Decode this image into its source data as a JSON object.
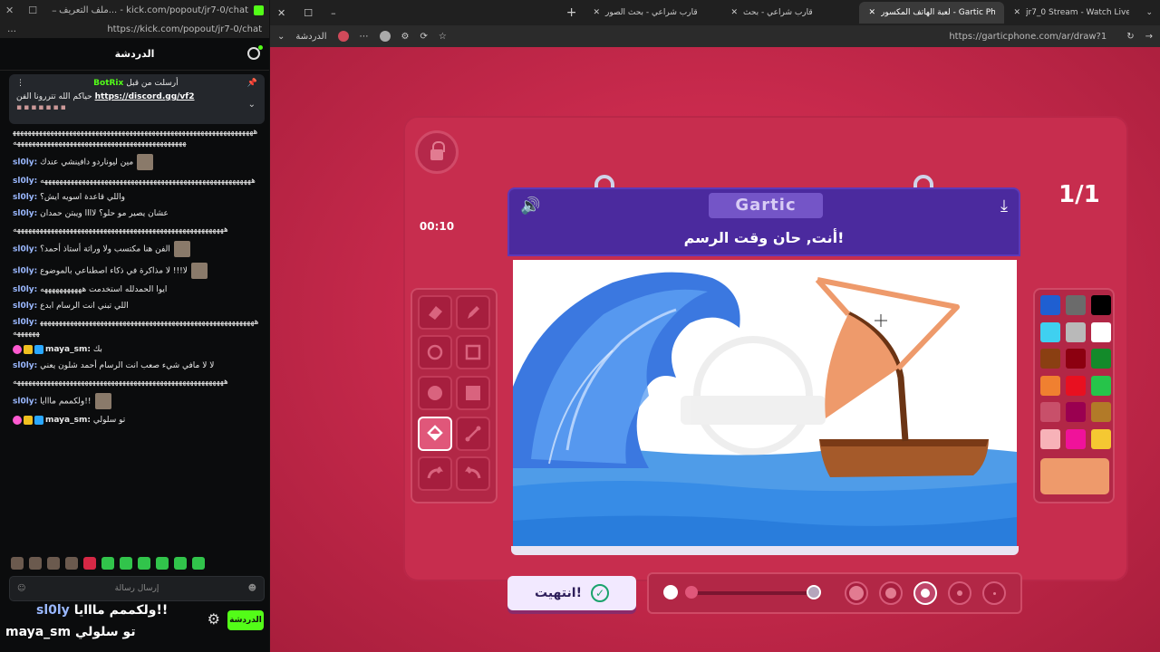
{
  "chat_window": {
    "title": "ملف التعريف... - kick.com/popout/jr7-0/chat",
    "url": "https://kick.com/popout/jr7-0/chat",
    "header": "الدردشة",
    "pinned": {
      "label": "أرسلت من قبل",
      "bot": "BotRix",
      "text": "حياكم الله تتررونا الفن",
      "link": "https://discord.gg/vf2"
    },
    "messages": [
      {
        "user": "",
        "text": "ههههههههههههههههههههههههههههههههههههههههههههههههههههههههههههههههههههههههههههههههههههههههههههههههههههههههههههههه"
      },
      {
        "user": "sl0ly:",
        "text": "مين ليوناردو دافينشي عندك"
      },
      {
        "user": "sl0ly:",
        "text": "ههههههههههههههههههههههههههههههههههههههههههههههههههههههههه"
      },
      {
        "user": "sl0ly:",
        "text": "واللي قاعدة اسويه ايش؟"
      },
      {
        "user": "sl0ly:",
        "text": "عشان يصير مو حلو؟ لاااا ويبتن حمدان"
      },
      {
        "user": "",
        "text": "ههههههههههههههههههههههههههههههههههههههههههههههههههههههههه"
      },
      {
        "user": "sl0ly:",
        "text": "الفن هنا مكتسب ولا وراثة أستاذ أحمد؟"
      },
      {
        "user": "sl0ly:",
        "text": "لا!!! لا مذاكرة في ذكاء اصطناعي بالموضوع"
      },
      {
        "user": "sl0ly:",
        "text": "ايوا الحمدلله استخدمت هههههههههههه"
      },
      {
        "user": "sl0ly:",
        "text": "اللي تبني انت الرسام ابدع"
      },
      {
        "user": "sl0ly:",
        "text": "ههههههههههههههههههههههههههههههههههههههههههههههههههههههههههههههههه"
      },
      {
        "user": "maya_sm:",
        "text": "بك"
      },
      {
        "user": "sl0ly:",
        "text": "لا لا مافي شيء صعب انت الرسام أحمد شلون يعني"
      },
      {
        "user": "",
        "text": "ههههههههههههههههههههههههههههههههههههههههههههههههههههههههه"
      },
      {
        "user": "sl0ly:",
        "text": "ولكممم مااايا!!"
      },
      {
        "user": "maya_sm:",
        "text": "تو سلولي"
      }
    ],
    "input_placeholder": "إرسال رسالة",
    "send_label": "الدردشة",
    "overlay_line1_user": "sl0ly",
    "overlay_line1_text": "ولكممم مااايا!!",
    "overlay_line2_user": "maya_sm",
    "overlay_line2_text": "تو سلولي"
  },
  "browser": {
    "tabs": [
      {
        "title": "jr7_0 Stream - Watch Live on Kick",
        "active": false
      },
      {
        "title": "لعبة الهاتف المكسور - Gartic Phone",
        "active": true
      },
      {
        "title": "قارب شراعي - بحث",
        "active": false
      },
      {
        "title": "قارب شراعي - بحث الصور",
        "active": false
      }
    ],
    "url": "https://garticphone.com/ar/draw?1",
    "bookmark_label": "الدردشة"
  },
  "game": {
    "timer": "00:10",
    "round": "1/1",
    "brand": "Gartic",
    "prompt": "أنت, حان وقت الرسم!",
    "done_label": "انتهيت!",
    "colors": {
      "accent": "#4b2a9e",
      "background": "#c92a4d",
      "current": "#ee9a6b"
    },
    "palette": [
      "#1f5fd1",
      "#6b6b6b",
      "#000000",
      "#3fd0f0",
      "#b9b9b9",
      "#ffffff",
      "#8a3f12",
      "#8c0010",
      "#138a2a",
      "#f08030",
      "#e81020",
      "#26c44a",
      "#c8506a",
      "#9a0050",
      "#b27a28",
      "#f7b2b8",
      "#f0129a",
      "#f5c832"
    ],
    "tools": [
      "eraser-icon",
      "pencil-icon",
      "circle-outline-icon",
      "square-outline-icon",
      "circle-fill-icon",
      "square-fill-icon",
      "bucket-icon",
      "line-icon",
      "undo-icon",
      "redo-icon"
    ]
  }
}
